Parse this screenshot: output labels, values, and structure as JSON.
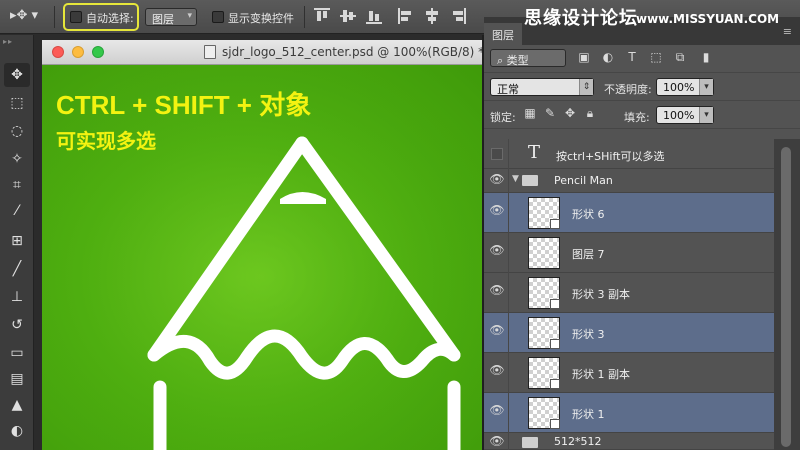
{
  "optbar": {
    "auto_select_label": "自动选择:",
    "auto_select_value": "图层",
    "show_transform_label": "显示变换控件"
  },
  "document": {
    "title": "sjdr_logo_512_center.psd @ 100%(RGB/8) *",
    "annotation_line1": "CTRL + SHIFT + 对象",
    "annotation_line2": "可实现多选"
  },
  "watermark": {
    "text": "思缘设计论坛",
    "url": "www.MISSYUAN.COM"
  },
  "layers_panel": {
    "tab_label": "图层",
    "menu_icon": "≡",
    "filter_value": "类型",
    "blend_mode": "正常",
    "opacity_label": "不透明度:",
    "opacity_value": "100%",
    "lock_label": "锁定:",
    "fill_label": "填充:",
    "fill_value": "100%",
    "text_layer_name": "按ctrl+SHift可以多选",
    "group_name": "Pencil Man",
    "layers": [
      {
        "name": "形状 6",
        "selected": true
      },
      {
        "name": "图层 7",
        "selected": false
      },
      {
        "name": "形状 3 副本",
        "selected": false
      },
      {
        "name": "形状 3",
        "selected": true
      },
      {
        "name": "形状 1 副本",
        "selected": false
      },
      {
        "name": "形状 1",
        "selected": true
      }
    ],
    "bottom_group_name": "512*512"
  },
  "colors": {
    "highlight_box": "#e6e63a",
    "annotation_text": "#f3f311",
    "canvas_green": "#4fb010",
    "selected_layer": "#5d6d8b"
  }
}
